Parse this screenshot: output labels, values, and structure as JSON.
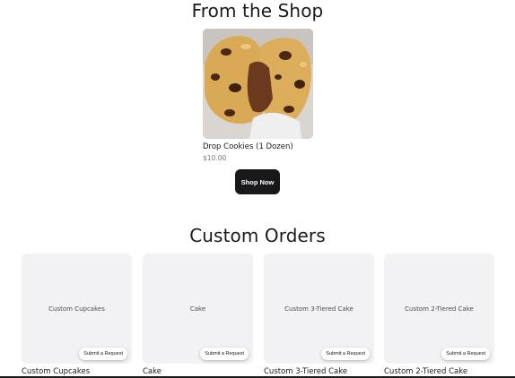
{
  "shop_section": {
    "title": "From the Shop",
    "product": {
      "name": "Drop Cookies (1 Dozen)",
      "price": "$10.00"
    },
    "shop_now_label": "Shop Now"
  },
  "custom_section": {
    "title": "Custom Orders",
    "request_label": "Submit a Request",
    "items": [
      {
        "tile_label": "Custom Cupcakes",
        "name": "Custom Cupcakes"
      },
      {
        "tile_label": "Cake",
        "name": "Cake"
      },
      {
        "tile_label": "Custom 3-Tiered Cake",
        "name": "Custom 3-Tiered Cake"
      },
      {
        "tile_label": "Custom 2-Tiered Cake",
        "name": "Custom 2-Tiered Cake"
      }
    ]
  },
  "colors": {
    "button_dark": "#18181b",
    "tile_background": "#f2f2f4",
    "price_gray": "#7a7a7a"
  }
}
